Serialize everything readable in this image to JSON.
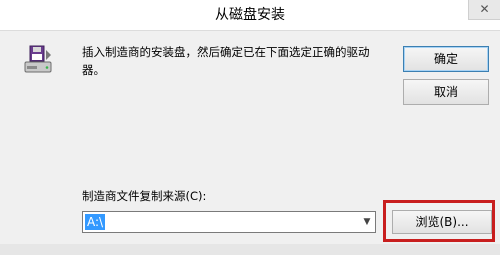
{
  "window": {
    "title": "从磁盘安装",
    "close_label": "✕"
  },
  "message": {
    "text": "插入制造商的安装盘，然后确定已在下面选定正确的驱动器。"
  },
  "buttons": {
    "ok_label": "确定",
    "cancel_label": "取消",
    "browse_label": "浏览(B)..."
  },
  "source": {
    "label": "制造商文件复制来源(C):",
    "value": "A:\\"
  },
  "icons": {
    "disk": "floppy-disk-install-icon",
    "dropdown": "chevron-down-icon"
  },
  "colors": {
    "selection": "#3399ff",
    "highlight_box": "#c81e1e"
  }
}
